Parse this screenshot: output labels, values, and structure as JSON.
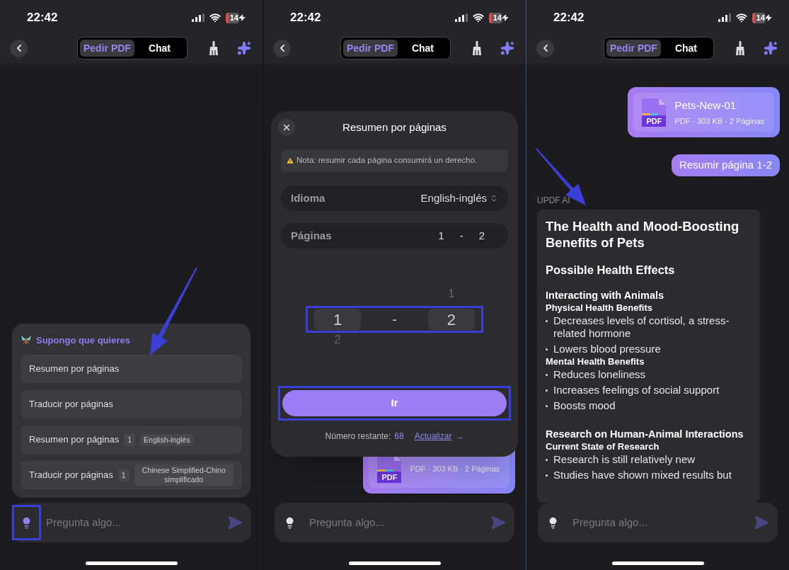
{
  "screens": [
    {
      "kind": "suggestions",
      "pointer_arrow": true,
      "status_bar": {
        "time": "22:42",
        "battery": "14"
      },
      "tabs": [
        {
          "label": "Pedir PDF",
          "selected": true
        },
        {
          "label": "Chat",
          "selected": false
        }
      ],
      "suggestions": {
        "title": "Supongo que quieres",
        "items": [
          {
            "kind": "plain",
            "label": "Resumen por páginas"
          },
          {
            "kind": "plain",
            "label": "Traducir por páginas"
          },
          {
            "kind": "preset",
            "label": "Resumen por páginas",
            "count": "1",
            "tag": "English-inglés"
          },
          {
            "kind": "preset",
            "label": "Traducir por páginas",
            "count": "1",
            "tag": "Chinese Simplified-Chino simplificado"
          }
        ]
      },
      "input": {
        "placeholder": "Pregunta algo...",
        "bulb_highlighted": true
      }
    },
    {
      "kind": "page_dialog",
      "pointer_arrow": false,
      "status_bar": {
        "time": "22:42",
        "battery": "14"
      },
      "tabs": [
        {
          "label": "Pedir PDF",
          "selected": true
        },
        {
          "label": "Chat",
          "selected": false
        }
      ],
      "dialog": {
        "title": "Resumen por páginas",
        "note": "Nota: resumir cada página consumirá un derecho.",
        "language": {
          "label": "Idioma",
          "value": "English-inglés"
        },
        "pages": {
          "label": "Páginas",
          "from": "1",
          "separator": "-",
          "to": "2"
        },
        "picker": {
          "highlighted": true,
          "from": "1",
          "separator": "-",
          "to": "2",
          "above_to": "1",
          "below_from": "2"
        },
        "go_button": {
          "label": "Ir",
          "highlighted": true
        },
        "remaining": {
          "label": "Número restante:",
          "count": "68"
        },
        "upgrade_link": {
          "label": "Actualizar",
          "arrow": "→"
        }
      },
      "file_card": {
        "type": "PDF",
        "meta": "PDF · 303 KB · 2 Páginas"
      },
      "input": {
        "placeholder": "Pregunta algo...",
        "bulb_highlighted": false
      }
    },
    {
      "kind": "chat",
      "pointer_arrow": true,
      "status_bar": {
        "time": "22:42",
        "battery": "14"
      },
      "tabs": [
        {
          "label": "Pedir PDF",
          "selected": true
        },
        {
          "label": "Chat",
          "selected": false
        }
      ],
      "file_card": {
        "type": "PDF",
        "name": "Pets-New-01",
        "meta": "PDF · 303 KB · 2 Páginas"
      },
      "user_message": "Resumir página 1-2",
      "ai_label": "UPDF AI",
      "response": [
        {
          "kind": "title",
          "text": "The Health and Mood-Boosting Benefits of Pets"
        },
        {
          "kind": "section",
          "text": "Possible Health Effects"
        },
        {
          "kind": "subsection",
          "text": "Interacting with Animals"
        },
        {
          "kind": "label",
          "text": "Physical Health Benefits"
        },
        {
          "kind": "bullet",
          "text": "Decreases levels of cortisol, a stress-related hormone"
        },
        {
          "kind": "bullet",
          "text": "Lowers blood pressure"
        },
        {
          "kind": "label",
          "text": "Mental Health Benefits"
        },
        {
          "kind": "bullet",
          "text": "Reduces loneliness"
        },
        {
          "kind": "bullet",
          "text": "Increases feelings of social support"
        },
        {
          "kind": "bullet",
          "text": "Boosts mood"
        },
        {
          "kind": "subsection",
          "text": "Research on Human-Animal Interactions"
        },
        {
          "kind": "label",
          "text": "Current State of Research"
        },
        {
          "kind": "bullet",
          "text": "Research is still relatively new"
        },
        {
          "kind": "bullet",
          "text": "Studies have shown mixed results but"
        }
      ],
      "input": {
        "placeholder": "Pregunta algo...",
        "bulb_highlighted": false
      }
    }
  ]
}
